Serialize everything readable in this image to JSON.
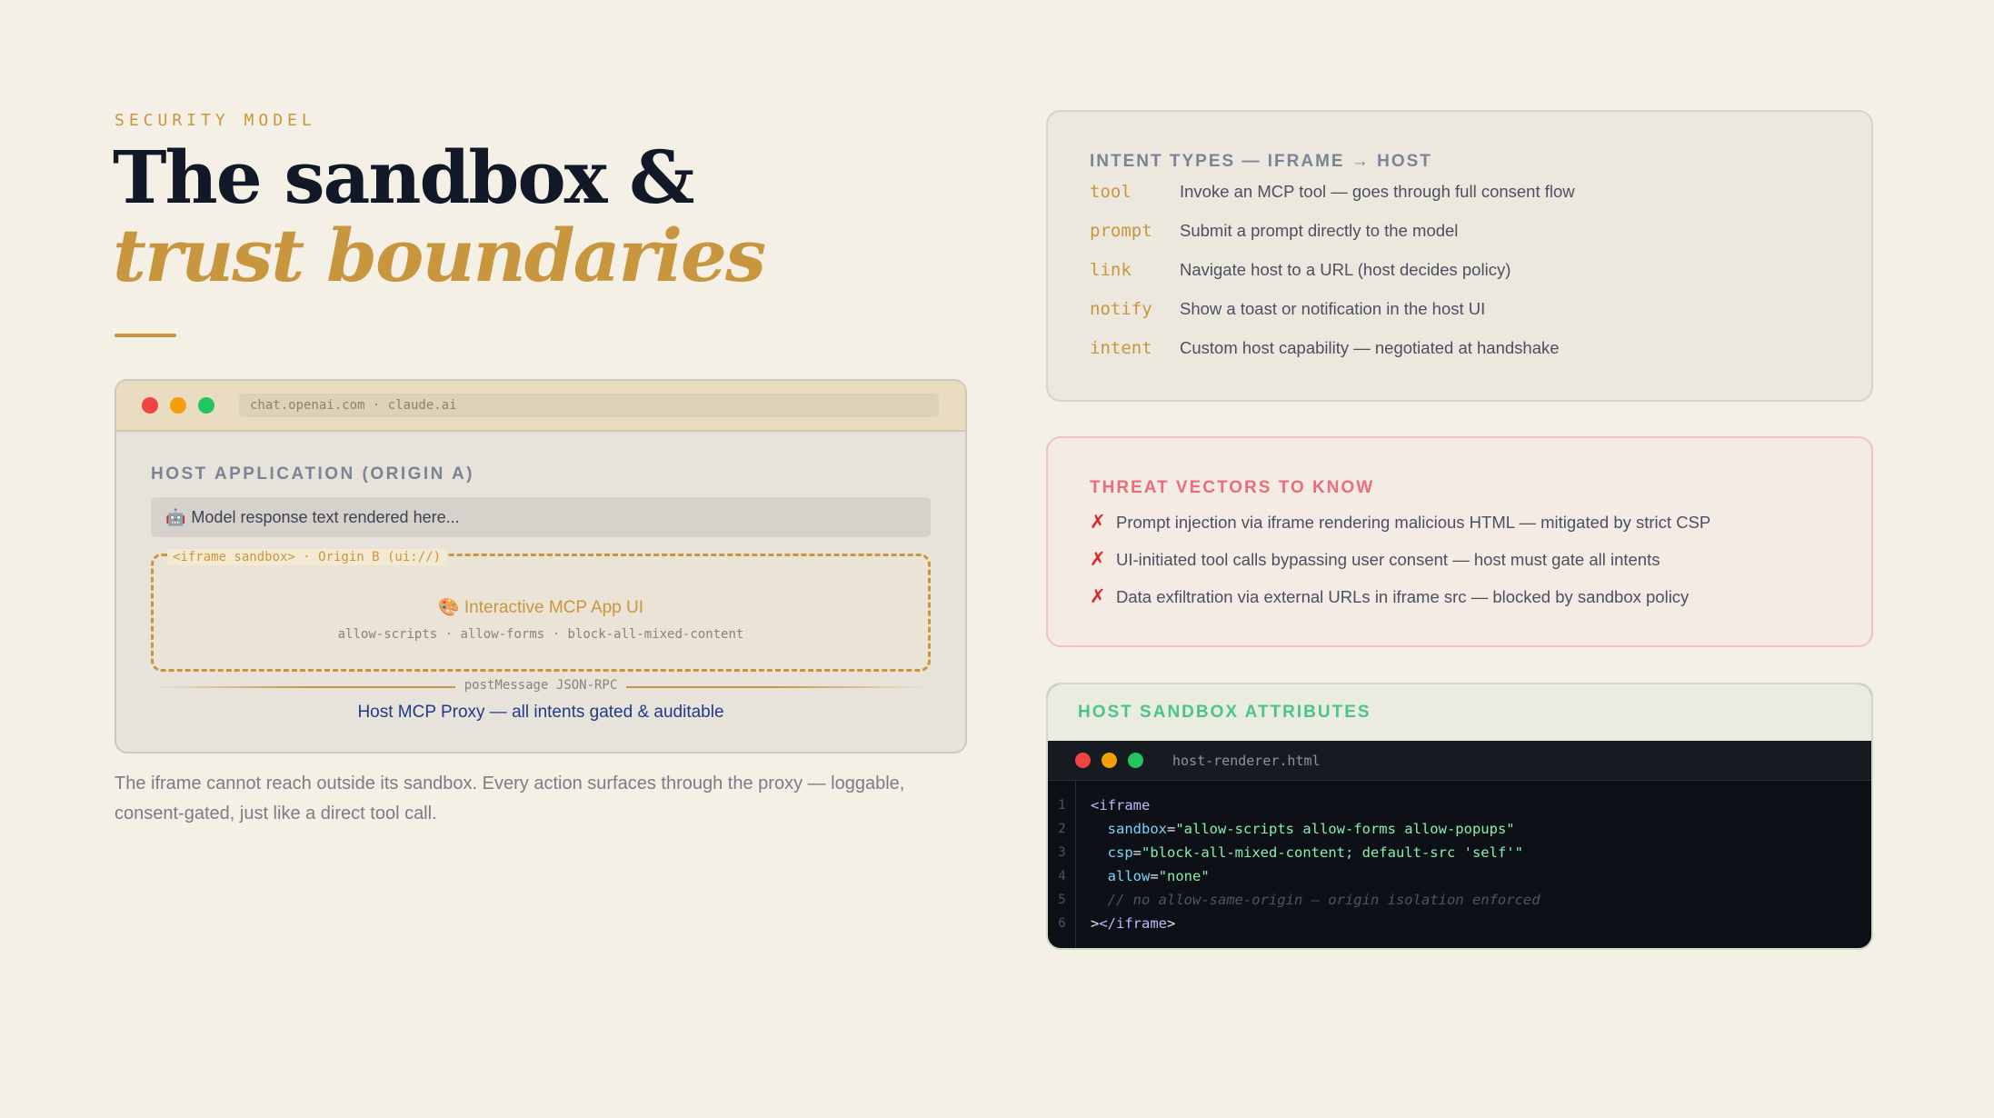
{
  "header": {
    "eyebrow": "SECURITY MODEL",
    "title": "The sandbox &",
    "title_accent": "trust boundaries"
  },
  "browser": {
    "url": "chat.openai.com · claude.ai",
    "host_label": "HOST APPLICATION (ORIGIN A)",
    "model_response_icon": "robot-emoji",
    "model_response": "Model response text rendered here...",
    "iframe_tag": "<iframe sandbox> · Origin B (ui://)",
    "mcp_ui_icon": "palette-emoji",
    "mcp_ui": "Interactive MCP App UI",
    "mcp_attrs": "allow-scripts · allow-forms · block-all-mixed-content",
    "proxy_tag": "postMessage JSON-RPC",
    "proxy_label": "Host MCP Proxy — all intents gated & auditable"
  },
  "caption": "The iframe cannot reach outside its sandbox. Every action surfaces through the proxy — loggable, consent-gated, just like a direct tool call.",
  "intents": {
    "heading": "INTENT TYPES — IFRAME → HOST",
    "items": [
      {
        "key": "tool",
        "desc": "Invoke an MCP tool — goes through full consent flow"
      },
      {
        "key": "prompt",
        "desc": "Submit a prompt directly to the model"
      },
      {
        "key": "link",
        "desc": "Navigate host to a URL (host decides policy)"
      },
      {
        "key": "notify",
        "desc": "Show a toast or notification in the host UI"
      },
      {
        "key": "intent",
        "desc": "Custom host capability — negotiated at handshake"
      }
    ]
  },
  "threats": {
    "heading": "THREAT VECTORS TO KNOW",
    "marker": "✗",
    "items": [
      "Prompt injection via iframe rendering malicious HTML — mitigated by strict CSP",
      "UI-initiated tool calls bypassing user consent — host must gate all intents",
      "Data exfiltration via external URLs in iframe src — blocked by sandbox policy"
    ]
  },
  "sandbox": {
    "heading": "HOST SANDBOX ATTRIBUTES",
    "filename": "host-renderer.html",
    "lines": [
      {
        "n": "1",
        "tag_open": "<iframe"
      },
      {
        "n": "2",
        "attr": "sandbox",
        "value": "\"allow-scripts allow-forms allow-popups\""
      },
      {
        "n": "3",
        "attr": "csp",
        "value": "\"block-all-mixed-content; default-src 'self'\""
      },
      {
        "n": "4",
        "attr": "allow",
        "value": "\"none\""
      },
      {
        "n": "5",
        "comment": "// no allow-same-origin — origin isolation enforced"
      },
      {
        "n": "6",
        "close_a": ">",
        "close_b": "</iframe",
        "close_c": ">"
      }
    ]
  },
  "colors": {
    "accent": "#c8963f",
    "background": "#f4f0e6",
    "threat": "#e76f7a",
    "sandbox_heading": "#4cc38a",
    "proxy_link": "#1e3a8a"
  }
}
